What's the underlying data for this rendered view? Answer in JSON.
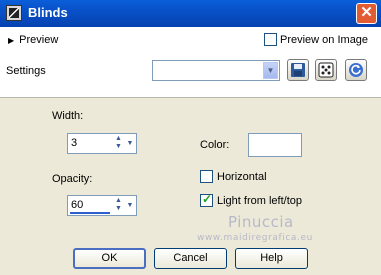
{
  "window": {
    "title": "Blinds",
    "close_glyph": "✕"
  },
  "preview": {
    "label": "Preview",
    "on_image_label": "Preview on Image",
    "on_image_checked": false
  },
  "settings": {
    "label": "Settings",
    "preset_value": ""
  },
  "tool_icons": [
    "save-icon",
    "dice-icon",
    "reset-icon"
  ],
  "fields": {
    "width": {
      "label": "Width:",
      "value": "3"
    },
    "opacity": {
      "label": "Opacity:",
      "value": "60"
    },
    "color": {
      "label": "Color:",
      "value_hex": "#ffffff"
    }
  },
  "options": {
    "horizontal": {
      "label": "Horizontal",
      "checked": false
    },
    "light_from_left_top": {
      "label": "Light from left/top",
      "checked": true
    }
  },
  "watermark": {
    "title": "Pinuccia",
    "url": "www.maidiregrafica.eu"
  },
  "buttons": {
    "ok": "OK",
    "cancel": "Cancel",
    "help": "Help"
  },
  "colors": {
    "title_bar": "#0850c8",
    "dialog_bg": "#ece9d8",
    "close": "#e35b32"
  }
}
